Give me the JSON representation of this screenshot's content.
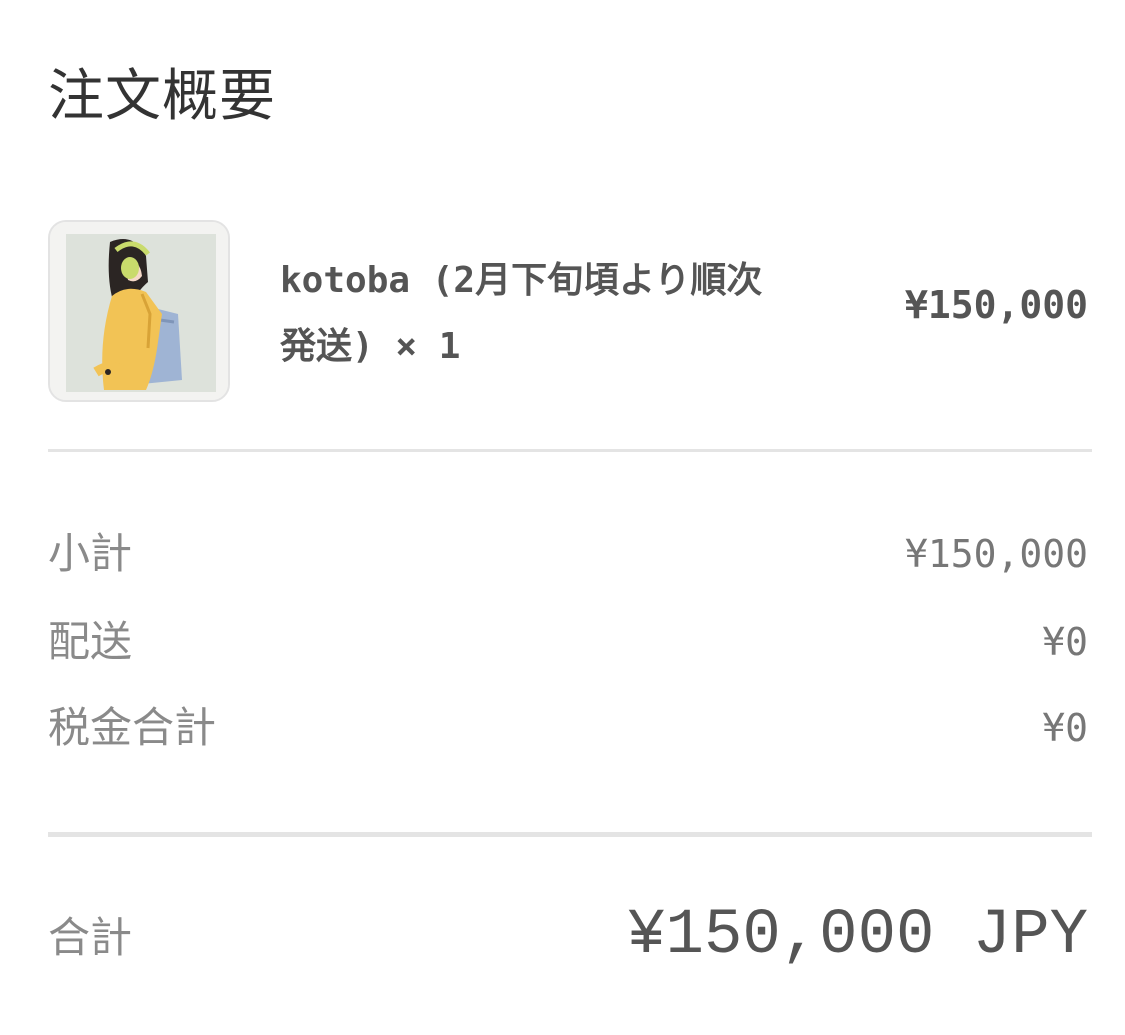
{
  "header": {
    "title": "注文概要"
  },
  "item": {
    "image": "product-thumbnail",
    "name": "kotoba (2月下旬頃より順次発送) × 1",
    "price": "¥150,000"
  },
  "lines": {
    "subtotal": {
      "label": "小計",
      "value": "¥150,000"
    },
    "shipping": {
      "label": "配送",
      "value": "¥0"
    },
    "tax": {
      "label": "税金合計",
      "value": "¥0"
    }
  },
  "total": {
    "label": "合計",
    "value": "¥150,000 JPY"
  },
  "colors": {
    "text_primary": "#333333",
    "text_secondary": "#8a8a8a",
    "divider": "#e4e4e4"
  }
}
